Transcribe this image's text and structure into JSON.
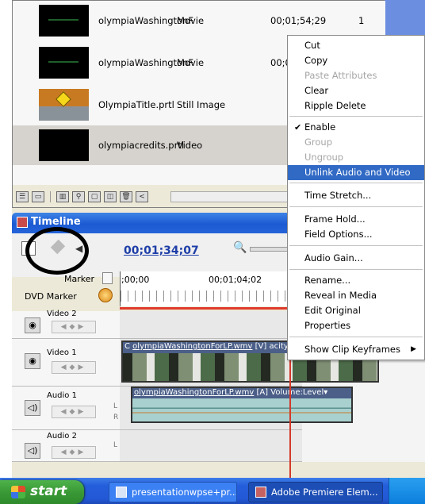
{
  "project": {
    "rows": [
      {
        "name": "olympiaWashingtonF",
        "type": "Movie",
        "duration": "00;01;54;29",
        "count": "1"
      },
      {
        "name": "olympiaWashingtonF",
        "type": "Movie",
        "duration": "00;0",
        "count": ""
      },
      {
        "name": "OlympiaTitle.prtl",
        "type": "Still Image",
        "duration": "",
        "count": ""
      },
      {
        "name": "olympiacredits.prtl",
        "type": "Video",
        "duration": "",
        "count": ""
      }
    ]
  },
  "timeline": {
    "title": "Timeline",
    "timecode": "00;01;34;07",
    "marker_label": "Marker",
    "dvd_marker_label": "DVD Marker",
    "ruler_start": ";00;00",
    "ruler_mid": "00;01;04;02",
    "tracks": {
      "video2": "Video 2",
      "video1": "Video 1",
      "audio1": "Audio 1",
      "audio2": "Audio 2"
    },
    "video_clip": {
      "prefix": "C",
      "name": "olympiaWashingtonForLP.wmv",
      "suffix": " [V]",
      "property": "acity"
    },
    "audio_clip": {
      "name": "olympiaWashingtonForLP.wmv",
      "suffix": " [A]",
      "property": "Volume:Level"
    },
    "L": "L",
    "R": "R"
  },
  "context_menu": {
    "items": [
      {
        "label": "Cut",
        "enabled": true
      },
      {
        "label": "Copy",
        "enabled": true
      },
      {
        "label": "Paste Attributes",
        "enabled": false
      },
      {
        "label": "Clear",
        "enabled": true
      },
      {
        "label": "Ripple Delete",
        "enabled": true
      },
      {
        "label": "Enable",
        "enabled": true,
        "checked": true
      },
      {
        "label": "Group",
        "enabled": false
      },
      {
        "label": "Ungroup",
        "enabled": false
      },
      {
        "label": "Unlink Audio and Video",
        "enabled": true,
        "highlighted": true
      },
      {
        "label": "Time Stretch...",
        "enabled": true
      },
      {
        "label": "Frame Hold...",
        "enabled": true
      },
      {
        "label": "Field Options...",
        "enabled": true
      },
      {
        "label": "Audio Gain...",
        "enabled": true
      },
      {
        "label": "Rename...",
        "enabled": true
      },
      {
        "label": "Reveal in Media",
        "enabled": true
      },
      {
        "label": "Edit Original",
        "enabled": true
      },
      {
        "label": "Properties",
        "enabled": true
      },
      {
        "label": "Show Clip Keyframes",
        "enabled": true,
        "submenu": true
      }
    ]
  },
  "taskbar": {
    "start_label": "start",
    "items": [
      {
        "label": "presentationwpse+pr..."
      },
      {
        "label": "Adobe Premiere Elem..."
      }
    ]
  }
}
